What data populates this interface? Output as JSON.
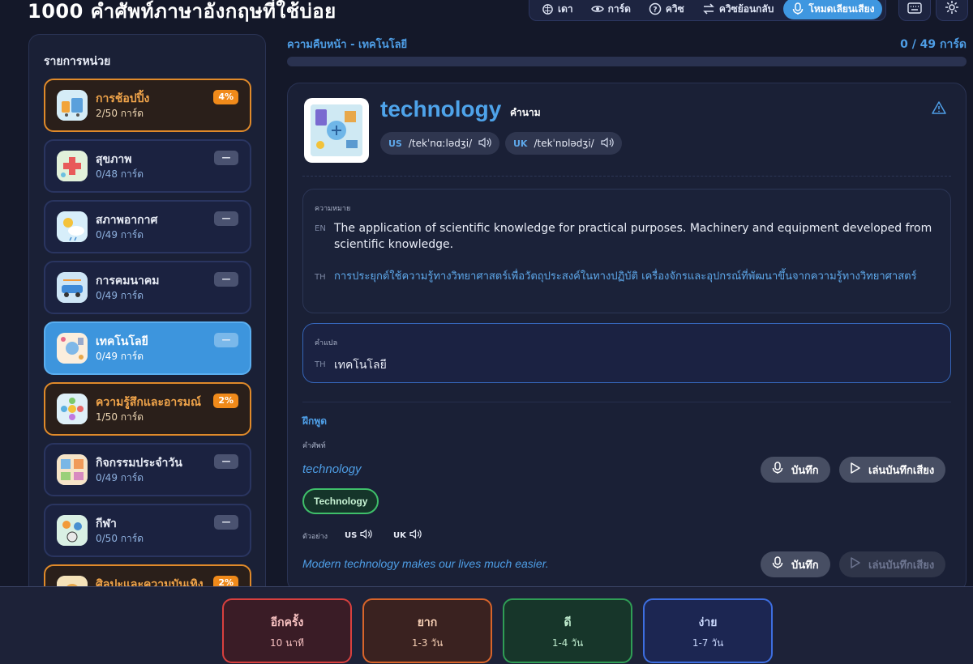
{
  "app": {
    "title": "1000 คำศัพท์ภาษาอังกฤษที่ใช้บ่อย"
  },
  "nav": {
    "items": [
      {
        "label": "เดา",
        "icon": "brain-icon",
        "active": false
      },
      {
        "label": "การ์ด",
        "icon": "eye-icon",
        "active": false
      },
      {
        "label": "ควิซ",
        "icon": "question-icon",
        "active": false
      },
      {
        "label": "ควิซย้อนกลับ",
        "icon": "swap-icon",
        "active": false
      },
      {
        "label": "โหมดเลียนเสียง",
        "icon": "mic-icon",
        "active": true
      }
    ],
    "keyboard_icon": "keyboard-icon",
    "settings_icon": "gear-icon"
  },
  "sidebar": {
    "title": "รายการหน่วย",
    "units": [
      {
        "name": "การช้อปปิ้ง",
        "count": "2/50 การ์ด",
        "badge": "4%",
        "style": "orange"
      },
      {
        "name": "สุขภาพ",
        "count": "0/48 การ์ด",
        "badge": "—",
        "style": "normal"
      },
      {
        "name": "สภาพอากาศ",
        "count": "0/49 การ์ด",
        "badge": "—",
        "style": "normal"
      },
      {
        "name": "การคมนาคม",
        "count": "0/49 การ์ด",
        "badge": "—",
        "style": "normal"
      },
      {
        "name": "เทคโนโลยี",
        "count": "0/49 การ์ด",
        "badge": "—",
        "style": "active"
      },
      {
        "name": "ความรู้สึกและอารมณ์",
        "count": "1/50 การ์ด",
        "badge": "2%",
        "style": "orange"
      },
      {
        "name": "กิจกรรมประจำวัน",
        "count": "0/49 การ์ด",
        "badge": "—",
        "style": "normal"
      },
      {
        "name": "กีฬา",
        "count": "0/50 การ์ด",
        "badge": "—",
        "style": "normal"
      },
      {
        "name": "ศิลปะและความบันเทิง",
        "count": "",
        "badge": "2%",
        "style": "orange"
      }
    ]
  },
  "progress": {
    "label": "ความคืบหน้า - เทคโนโลยี",
    "count": "0 / 49 การ์ด",
    "fraction": 0
  },
  "card": {
    "word": "technology",
    "pos": "คำนาม",
    "pron_us_tag": "US",
    "pron_us": "/tekˈnɑːlədʒi/",
    "pron_uk_tag": "UK",
    "pron_uk": "/tekˈnɒlədʒi/",
    "meaning_label": "ความหมาย",
    "en_tag": "EN",
    "def_en": "The application of scientific knowledge for practical purposes. Machinery and equipment developed from scientific knowledge.",
    "th_tag": "TH",
    "def_th": "การประยุกต์ใช้ความรู้ทางวิทยาศาสตร์เพื่อวัตถุประสงค์ในทางปฏิบัติ เครื่องจักรและอุปกรณ์ที่พัฒนาขึ้นจากความรู้ทางวิทยาศาสตร์",
    "translation_label": "คำแปล",
    "translation_th": "เทคโนโลยี"
  },
  "practice": {
    "title": "ฝึกพูด",
    "vocab_label": "คำศัพท์",
    "word": "technology",
    "record_label": "บันทึก",
    "play_label": "เล่นบันทึกเสียง",
    "recognized": "Technology",
    "example_label": "ตัวอย่าง",
    "tts_us": "US",
    "tts_uk": "UK",
    "example": "Modern technology makes our lives much easier."
  },
  "grades": [
    {
      "label": "อีกครั้ง",
      "sub": "10 นาที"
    },
    {
      "label": "ยาก",
      "sub": "1-3 วัน"
    },
    {
      "label": "ดี",
      "sub": "1-4 วัน"
    },
    {
      "label": "ง่าย",
      "sub": "1-7 วัน"
    }
  ],
  "colors": {
    "accent": "#3f97e0",
    "orange": "#e08a2a",
    "again": "#d8403e",
    "hard": "#d8642a",
    "good": "#2f9d55",
    "easy": "#3d6ee0"
  }
}
